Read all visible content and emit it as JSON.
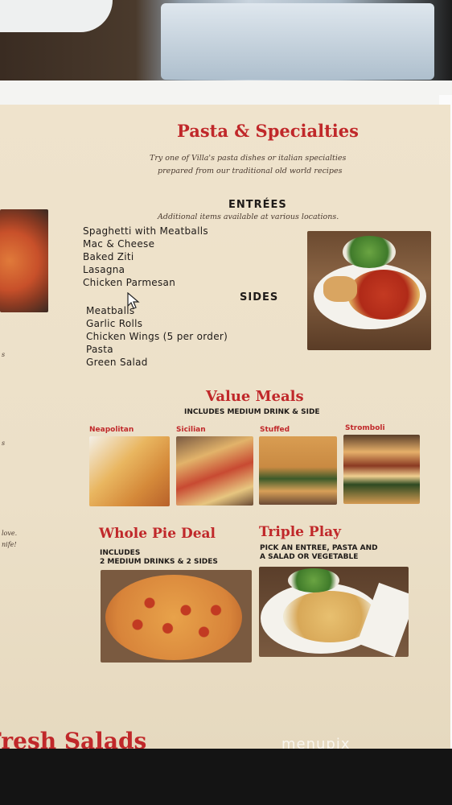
{
  "page": {
    "heading": "Pasta & Specialties",
    "subtitle_line1": "Try one of Villa's pasta dishes or italian specialties",
    "subtitle_line2": "prepared from our traditional old world recipes"
  },
  "entrees": {
    "title": "ENTRÉES",
    "note": "Additional items available at various locations.",
    "items": [
      "Spaghetti with Meatballs",
      "Mac & Cheese",
      "Baked Ziti",
      "Lasagna",
      "Chicken Parmesan"
    ]
  },
  "sides": {
    "title": "SIDES",
    "items": [
      "Meatballs",
      "Garlic Rolls",
      "Chicken Wings (5 per order)",
      "Pasta",
      "Green Salad"
    ]
  },
  "value_meals": {
    "title": "Value Meals",
    "subtitle": "INCLUDES MEDIUM DRINK & SIDE",
    "options": [
      "Neapolitan",
      "Sicilian",
      "Stuffed",
      "Stromboli"
    ]
  },
  "whole_pie": {
    "title": "Whole Pie Deal",
    "line1": "INCLUDES",
    "line2": "2 MEDIUM DRINKS & 2 SIDES"
  },
  "triple_play": {
    "title": "Triple Play",
    "line1": "PICK AN ENTREE, PASTA AND",
    "line2": "A SALAD OR VEGETABLE"
  },
  "footer": {
    "next_section": "Fresh Salads",
    "watermark": "menupix"
  },
  "left_fragments": [
    "s",
    "s",
    "love.",
    "nife!"
  ],
  "colors": {
    "accent_red": "#c0282a",
    "menu_bg": "#efe3cc",
    "text_dark": "#1e1a18"
  },
  "icons": {
    "cursor": "mouse-pointer-icon"
  }
}
